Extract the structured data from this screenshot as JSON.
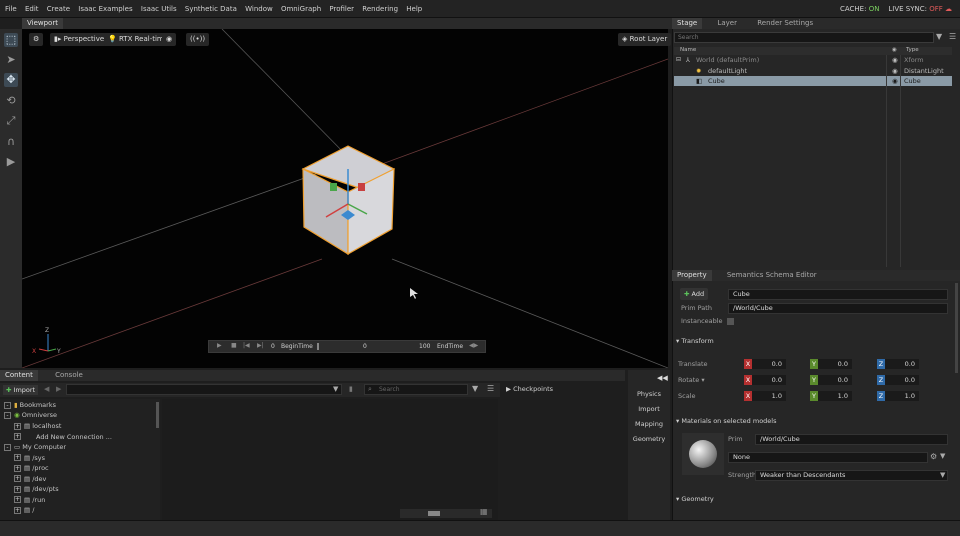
{
  "menubar": {
    "items": [
      "File",
      "Edit",
      "Create",
      "Isaac Examples",
      "Isaac Utils",
      "Synthetic Data",
      "Window",
      "OmniGraph",
      "Profiler",
      "Rendering",
      "Help"
    ],
    "cache_label": "CACHE:",
    "cache_value": "ON",
    "live_sync_label": "LIVE SYNC:",
    "live_sync_value": "OFF"
  },
  "viewport": {
    "tab": "Viewport",
    "camera": "Perspective",
    "renderer": "RTX Real-time",
    "root_layer": "Root Layer",
    "timeline": {
      "start": "0",
      "begin_label": "BeginTime",
      "current": "0",
      "end": "100",
      "end_label": "EndTime"
    }
  },
  "stage": {
    "tabs": [
      "Stage",
      "Layer",
      "Render Settings"
    ],
    "search_placeholder": "Search",
    "columns": {
      "name": "Name",
      "type": "Type"
    },
    "rows": [
      {
        "name": "World (defaultPrim)",
        "type": "Xform"
      },
      {
        "name": "defaultLight",
        "type": "DistantLight"
      },
      {
        "name": "Cube",
        "type": "Cube"
      }
    ]
  },
  "property": {
    "tabs": [
      "Property",
      "Semantics Schema Editor"
    ],
    "add_label": "Add",
    "prim_name": "Cube",
    "prim_path_label": "Prim Path",
    "prim_path": "/World/Cube",
    "instanceable_label": "Instanceable",
    "transform_section": "Transform",
    "translate_label": "Translate",
    "rotate_label": "Rotate ▾",
    "scale_label": "Scale",
    "translate": [
      "0.0",
      "0.0",
      "0.0"
    ],
    "rotate": [
      "0.0",
      "0.0",
      "0.0"
    ],
    "scale": [
      "1.0",
      "1.0",
      "1.0"
    ],
    "axes": [
      "X",
      "Y",
      "Z"
    ],
    "materials_section": "Materials on selected models",
    "prim_label": "Prim",
    "material_prim": "/World/Cube",
    "material_value": "None",
    "strength_label": "Strength",
    "strength_value": "Weaker than Descendants",
    "geometry_section": "Geometry"
  },
  "content": {
    "tabs": [
      "Content",
      "Console"
    ],
    "import_label": "Import",
    "search_placeholder": "Search",
    "checkpoints": "Checkpoints",
    "tree": [
      {
        "label": "Bookmarks"
      },
      {
        "label": "Omniverse"
      },
      {
        "label": "localhost"
      },
      {
        "label": "Add New Connection ..."
      },
      {
        "label": "My Computer"
      },
      {
        "label": "/sys"
      },
      {
        "label": "/proc"
      },
      {
        "label": "/dev"
      },
      {
        "label": "/dev/pts"
      },
      {
        "label": "/run"
      },
      {
        "label": "/"
      }
    ],
    "side_buttons": [
      "Physics",
      "Import",
      "Mapping",
      "Geometry"
    ]
  },
  "colors": {
    "accent_orange": "#f0a030",
    "axis_x": "#b53030",
    "axis_y": "#5a8a2c",
    "axis_z": "#2f6aa8"
  }
}
